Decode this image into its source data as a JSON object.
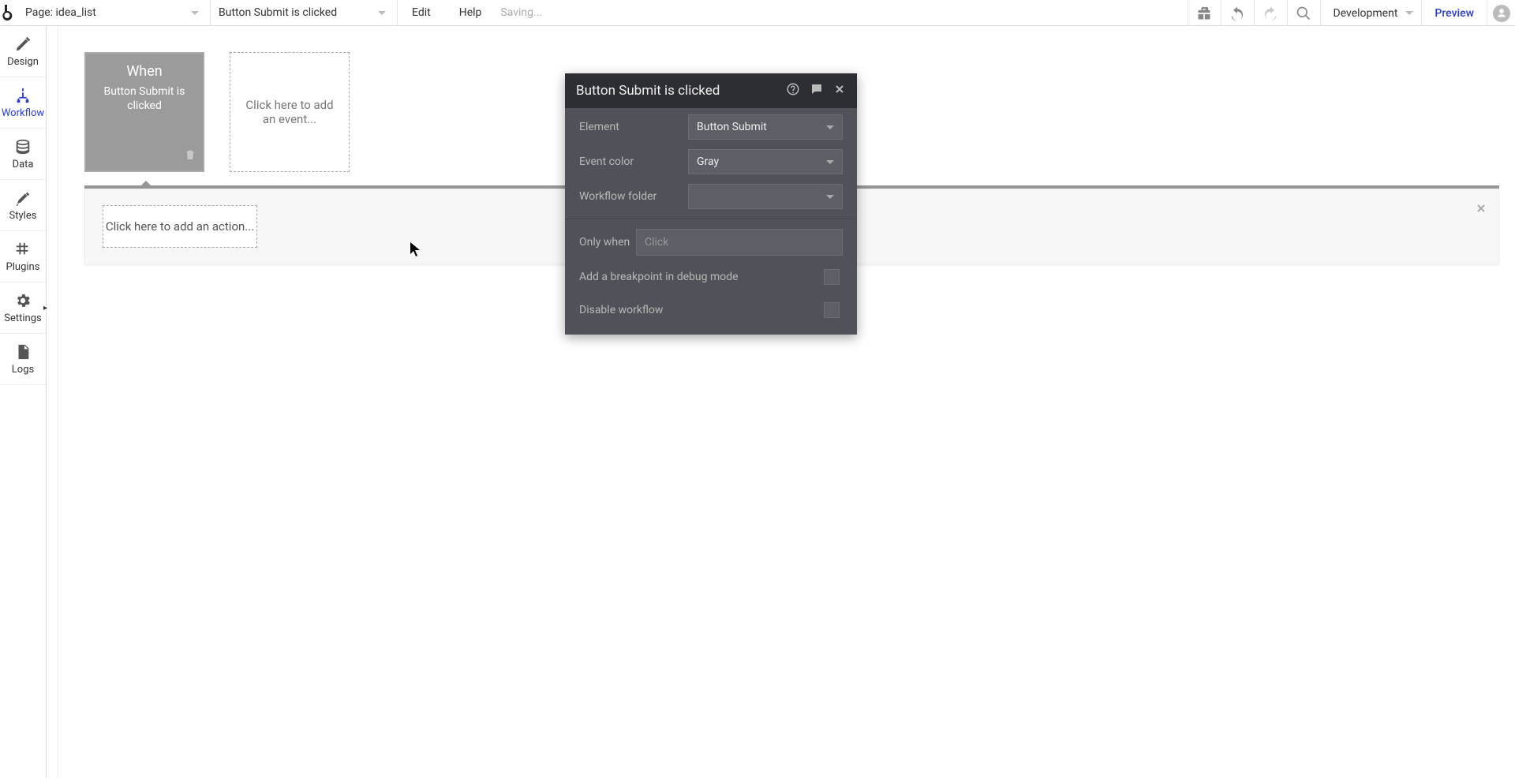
{
  "topbar": {
    "page_label_prefix": "Page: ",
    "page_name": "idea_list",
    "event_label": "Button Submit is clicked",
    "edit": "Edit",
    "help": "Help",
    "saving": "Saving...",
    "development": "Development",
    "preview": "Preview"
  },
  "sidebar": {
    "items": [
      {
        "label": "Design"
      },
      {
        "label": "Workflow"
      },
      {
        "label": "Data"
      },
      {
        "label": "Styles"
      },
      {
        "label": "Plugins"
      },
      {
        "label": "Settings"
      },
      {
        "label": "Logs"
      }
    ],
    "active_index": 1
  },
  "workflow": {
    "event": {
      "when": "When",
      "description": "Button Submit is clicked"
    },
    "add_event": "Click here to add an event...",
    "add_action": "Click here to add an action..."
  },
  "panel": {
    "title": "Button Submit is clicked",
    "rows": {
      "element_label": "Element",
      "element_value": "Button Submit",
      "event_color_label": "Event color",
      "event_color_value": "Gray",
      "workflow_folder_label": "Workflow folder",
      "workflow_folder_value": "",
      "only_when_label": "Only when",
      "only_when_placeholder": "Click",
      "breakpoint_label": "Add a breakpoint in debug mode",
      "disable_label": "Disable workflow"
    }
  }
}
